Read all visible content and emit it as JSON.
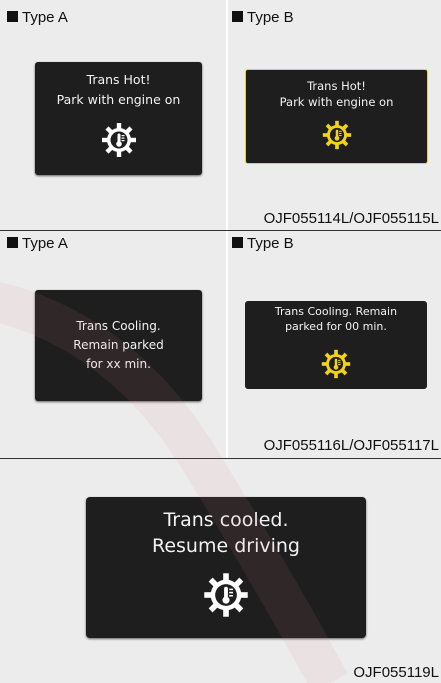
{
  "section1": {
    "left": {
      "type_label": "Type A",
      "message": "Trans Hot!\nPark with engine on",
      "icon": "trans-temp-gear-icon",
      "icon_color": "#ffffff"
    },
    "right": {
      "type_label": "Type B",
      "message": "Trans Hot!\nPark with engine on",
      "icon": "trans-temp-gear-icon",
      "icon_color": "#f2d21a"
    },
    "code": "OJF055114L/OJF055115L"
  },
  "section2": {
    "left": {
      "type_label": "Type A",
      "message": "Trans Cooling.\nRemain parked\nfor xx min."
    },
    "right": {
      "type_label": "Type B",
      "message": "Trans Cooling. Remain\nparked for 00 min.",
      "icon": "trans-temp-gear-icon",
      "icon_color": "#f2d21a"
    },
    "code": "OJF055116L/OJF055117L"
  },
  "section3": {
    "center": {
      "message": "Trans cooled.\nResume driving",
      "icon": "trans-temp-gear-icon",
      "icon_color": "#ffffff"
    },
    "code": "OJF055119L"
  },
  "colors": {
    "panel_bg": "#ececec",
    "screen_bg": "#1e1e1e",
    "screen_text": "#f2f2f2",
    "type_b_border": "#e8cf20",
    "type_b_icon": "#f2d21a"
  }
}
